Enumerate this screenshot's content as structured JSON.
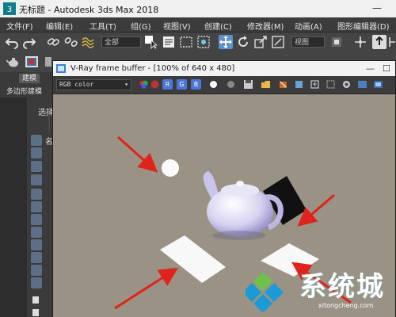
{
  "window": {
    "title": "无标题 - Autodesk 3ds Max 2018",
    "minimize_glyph": "—"
  },
  "menu": {
    "items": [
      "文件(F)",
      "编辑(E)",
      "工具(T)",
      "组(G)",
      "视图(V)",
      "创建(C)",
      "修改器(M)",
      "动画(A)",
      "图形编辑器(D)"
    ]
  },
  "toolbar": {
    "selection_filter": "全部",
    "view_dropdown": "视图"
  },
  "ribbon": {
    "modeling_tab": "建模",
    "poly_label": "多边形建模"
  },
  "left_panel": {
    "select_label": "选择",
    "name_label": "名"
  },
  "vfb": {
    "title": "V-Ray frame buffer - [100% of 640 x 480]",
    "channel": "RGB color",
    "channel_arrow": "▾",
    "btn_min": "—",
    "btn_max": "☐",
    "btn_r": "R",
    "btn_g": "G",
    "btn_b": "B"
  },
  "watermark": {
    "text": "系统城",
    "url": "xitongcheng.com"
  },
  "colors": {
    "viewport_bg": "#9a9284",
    "arrow": "#e0231c",
    "ui_dark": "#444444",
    "watermark_blue": "#1c9ad6",
    "watermark_green": "#6cc24a"
  },
  "icons": [
    "3dsmax-logo-icon",
    "undo-icon",
    "redo-icon",
    "link-icon",
    "unlink-icon",
    "bind-space-warp-icon",
    "select-object-icon",
    "select-by-name-icon",
    "rectangle-select-icon",
    "window-crossing-icon",
    "move-icon",
    "rotate-icon",
    "scale-icon",
    "snap-icon",
    "vray-icon"
  ]
}
